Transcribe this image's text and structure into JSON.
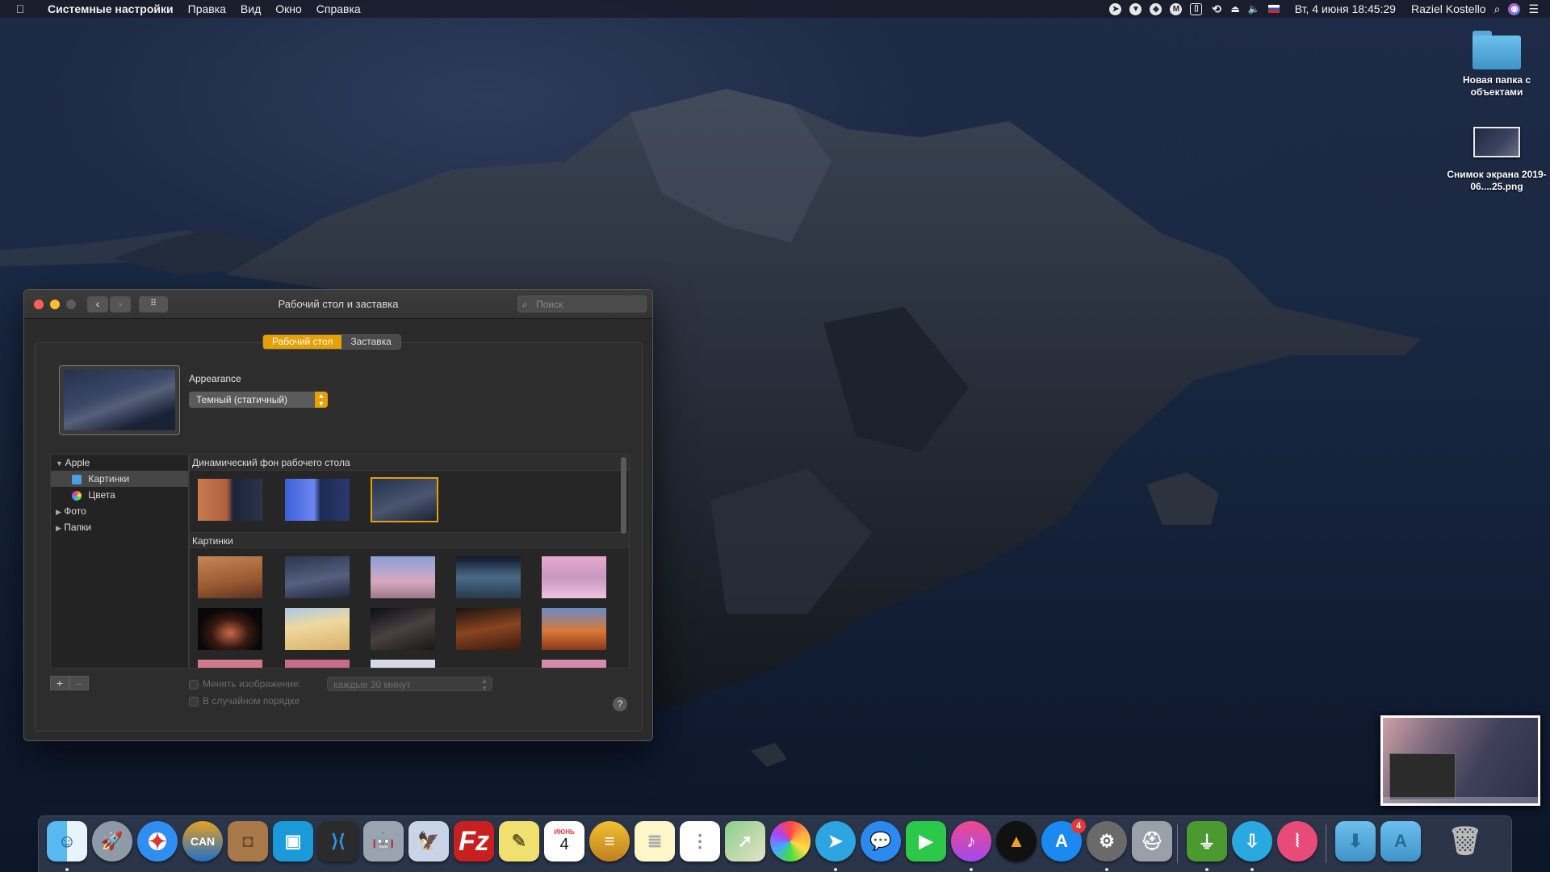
{
  "menubar": {
    "app": "Системные настройки",
    "menus": [
      "Правка",
      "Вид",
      "Окно",
      "Справка"
    ],
    "datetime": "Вт, 4 июня  18:45:29",
    "user": "Raziel Kostello"
  },
  "desktop": {
    "icons": [
      {
        "label": "Новая папка с объектами",
        "type": "folder"
      },
      {
        "label": "Снимок экрана 2019-06....25.png",
        "type": "screenshot"
      }
    ]
  },
  "window": {
    "title": "Рабочий стол и заставка",
    "search_placeholder": "Поиск",
    "tabs": [
      {
        "label": "Рабочий стол",
        "active": true
      },
      {
        "label": "Заставка",
        "active": false
      }
    ],
    "appearance_label": "Appearance",
    "appearance_value": "Темный (статичный)",
    "sidebar": [
      {
        "label": "Apple",
        "kind": "group",
        "expanded": true
      },
      {
        "label": "Картинки",
        "kind": "item",
        "selected": true
      },
      {
        "label": "Цвета",
        "kind": "item"
      },
      {
        "label": "Фото",
        "kind": "group"
      },
      {
        "label": "Папки",
        "kind": "group"
      }
    ],
    "sections": [
      {
        "title": "Динамический фон рабочего стола"
      },
      {
        "title": "Картинки"
      }
    ],
    "change_picture_label": "Менять изображение:",
    "interval_value": "каждые 30 минут",
    "random_order_label": "В случайном порядке",
    "help": "?"
  },
  "dock": {
    "app_store_badge": "4",
    "calendar_month": "ИЮНЬ",
    "calendar_day": "4",
    "apps": [
      "Finder",
      "Launchpad",
      "Safari",
      "CAN",
      "Contacts",
      "Frame",
      "Visual Studio Code",
      "Automator",
      "Preview",
      "FileZilla",
      "Stickies",
      "Calendar",
      "Sequel Pro",
      "Notes",
      "Reminders",
      "Maps",
      "Photos",
      "Telegram",
      "Messages",
      "FaceTime",
      "iTunes",
      "Transmit",
      "App Store",
      "System Preferences",
      "Disk Utility",
      "USB",
      "Archive",
      "Zip",
      "Downloads",
      "Applications",
      "Trash"
    ]
  }
}
